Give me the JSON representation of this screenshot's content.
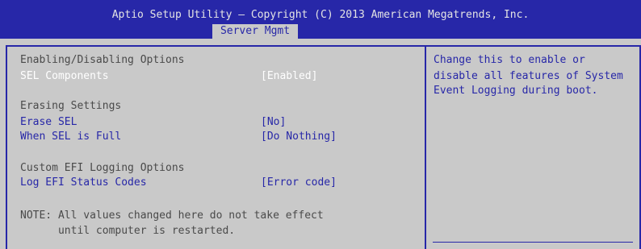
{
  "header": {
    "title": "Aptio Setup Utility – Copyright (C) 2013 American Megatrends, Inc.",
    "active_tab": "Server Mgmt"
  },
  "settings": {
    "section1_heading": "Enabling/Disabling Options",
    "sel_components": {
      "label": "SEL Components",
      "value": "[Enabled]"
    },
    "section2_heading": "Erasing Settings",
    "erase_sel": {
      "label": "Erase SEL",
      "value": "[No]"
    },
    "when_sel_full": {
      "label": "When SEL is Full",
      "value": "[Do Nothing]"
    },
    "section3_heading": "Custom EFI Logging Options",
    "log_efi": {
      "label": "Log EFI Status Codes",
      "value": "[Error code]"
    },
    "note_line1": "NOTE: All values changed here do not take effect",
    "note_line2": "      until computer is restarted."
  },
  "help": {
    "line1": "Change this to enable or",
    "line2": "disable all features of System",
    "line3": "Event Logging during boot."
  },
  "colors": {
    "header_bg": "#2727a8",
    "panel_bg": "#c9c9c9",
    "selected_text": "#ffffff",
    "option_text": "#2727a8",
    "static_text": "#4a4a4a"
  }
}
